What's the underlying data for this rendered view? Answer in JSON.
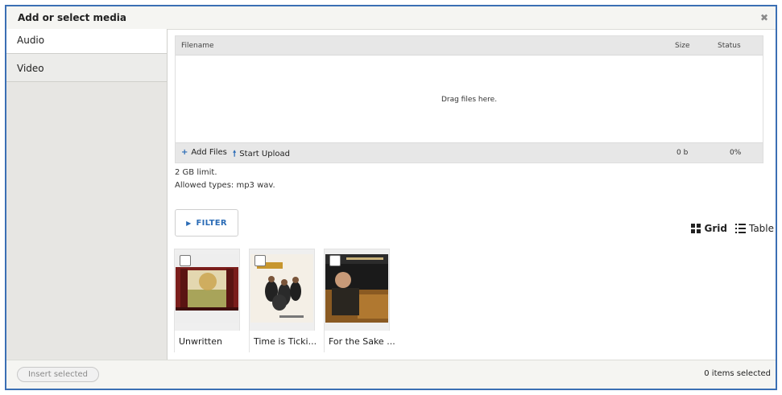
{
  "dialog": {
    "title": "Add or select media",
    "close_icon": "close-icon"
  },
  "sidebar": {
    "tabs": [
      {
        "label": "Audio",
        "active": true
      },
      {
        "label": "Video",
        "active": false
      }
    ]
  },
  "uploader": {
    "columns": {
      "filename": "Filename",
      "size": "Size",
      "status": "Status"
    },
    "drop_text": "Drag files here.",
    "add_files_label": "Add Files",
    "start_upload_label": "Start Upload",
    "total_size": "0 b",
    "total_status": "0%",
    "limit_text": "2 GB limit.",
    "allowed_text": "Allowed types: mp3 wav."
  },
  "filter": {
    "label": "FILTER"
  },
  "view_modes": {
    "grid_label": "Grid",
    "table_label": "Table",
    "selected": "Grid"
  },
  "media_items": [
    {
      "name": "Unwritten",
      "checked": false
    },
    {
      "name": "Time is Ticki...",
      "checked": false
    },
    {
      "name": "For the Sake ...",
      "checked": false
    }
  ],
  "footer": {
    "insert_label": "Insert selected",
    "selected_count": "0 items selected"
  },
  "colors": {
    "accent": "#2b6cb6",
    "frame_border": "#3b6fb4",
    "sidebar_bg": "#e7e6e3"
  }
}
